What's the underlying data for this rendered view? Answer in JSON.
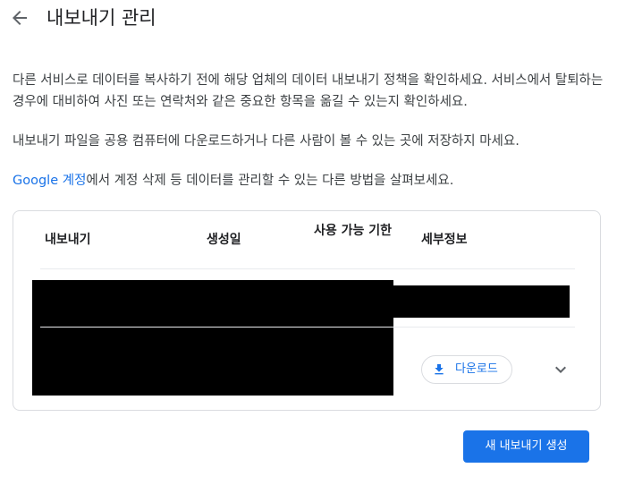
{
  "header": {
    "back_icon": "arrow-back-icon",
    "title": "내보내기 관리"
  },
  "intro": {
    "paragraph1": "다른 서비스로 데이터를 복사하기 전에 해당 업체의 데이터 내보내기 정책을 확인하세요. 서비스에서 탈퇴하는 경우에 대비하여 사진 또는 연락처와 같은 중요한 항목을 옮길 수 있는지 확인하세요.",
    "paragraph2": "내보내기 파일을 공용 컴퓨터에 다운로드하거나 다른 사람이 볼 수 있는 곳에 저장하지 마세요.",
    "paragraph3_link": "Google 계정",
    "paragraph3_rest": "에서 계정 삭제 등 데이터를 관리할 수 있는 다른 방법을 살펴보세요."
  },
  "exports_table": {
    "columns": [
      "내보내기",
      "생성일",
      "사용 가능 기한",
      "세부정보"
    ],
    "row": {
      "download_label": "다운로드",
      "download_icon": "download-icon",
      "expand_icon": "chevron-down-icon"
    }
  },
  "footer": {
    "create_label": "새 내보내기 생성"
  },
  "colors": {
    "accent": "#1a73e8",
    "text": "#202124",
    "border": "#dadce0"
  }
}
